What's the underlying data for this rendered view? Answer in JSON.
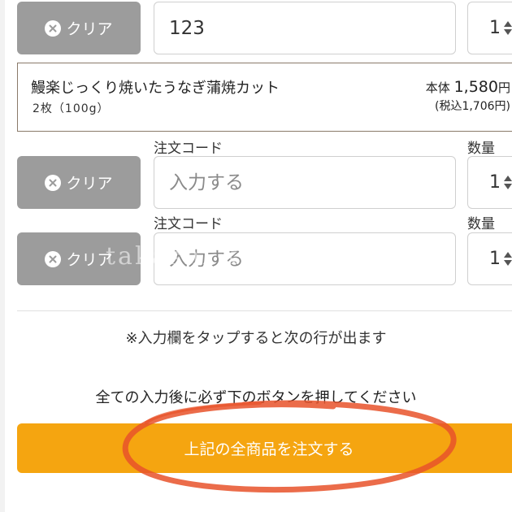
{
  "colors": {
    "clear_button": "#9c9c9c",
    "order_button": "#f5a510",
    "annotation_circle": "#e8522a"
  },
  "rows": [
    {
      "clear_label": "クリア",
      "code_value": "123",
      "code_placeholder": "",
      "qty": "1"
    },
    {
      "code_label": "注文コード",
      "qty_label": "数量",
      "clear_label": "クリア",
      "code_value": "",
      "code_placeholder": "入力する",
      "qty": "1"
    },
    {
      "code_label": "注文コード",
      "qty_label": "数量",
      "clear_label": "クリア",
      "code_value": "",
      "code_placeholder": "入力する",
      "qty": "1"
    }
  ],
  "product": {
    "name": "鰻楽じっくり焼いたうなぎ蒲焼カット",
    "sub": "2枚（100g）",
    "price_prefix": "本体 ",
    "price_value": "1,580",
    "price_suffix": "円",
    "price_tax": "(税込1,706円)"
  },
  "note": "※入力欄をタップすると次の行が出ます",
  "instruction": "全ての入力後に必ず下のボタンを押してください",
  "order_button": "上記の全商品を注文する",
  "watermark": "takashi kurashi"
}
